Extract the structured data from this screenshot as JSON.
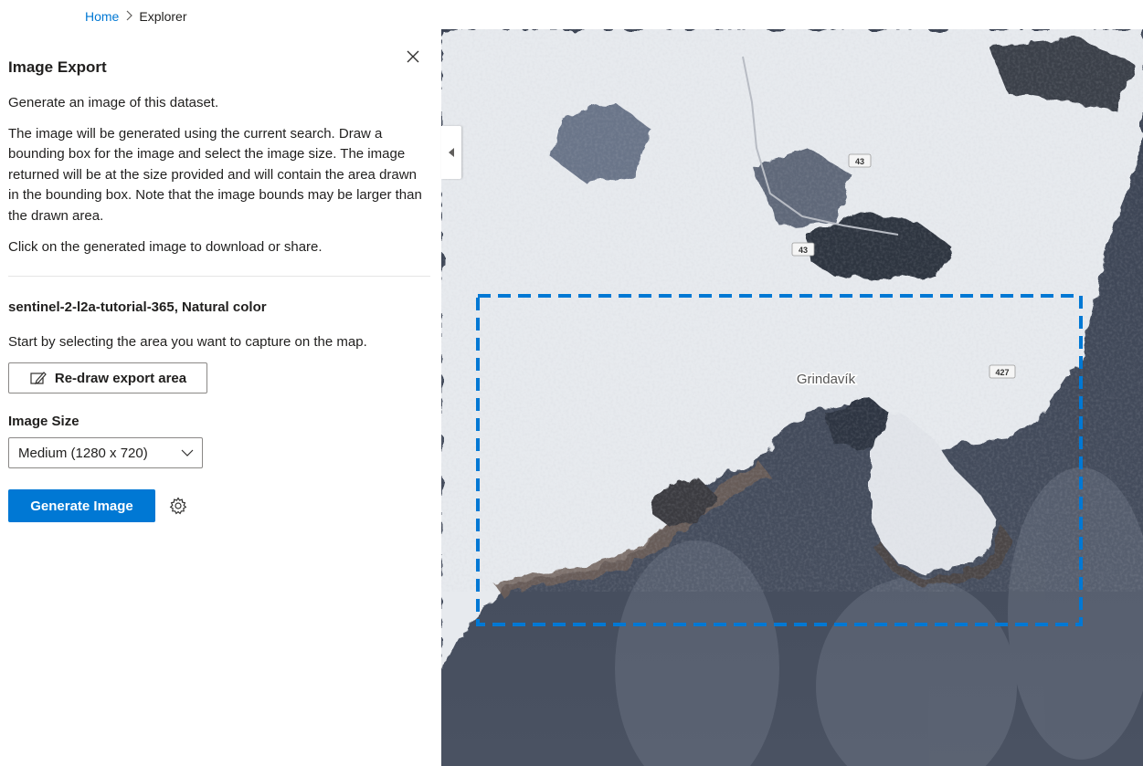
{
  "breadcrumb": {
    "home": "Home",
    "current": "Explorer"
  },
  "panel": {
    "title": "Image Export",
    "intro_1": "Generate an image of this dataset.",
    "intro_2": "The image will be generated using the current search. Draw a bounding box for the image and select the image size. The image returned will be at the size provided and will contain the area drawn in the bounding box. Note that the image bounds may be larger than the drawn area.",
    "intro_3": "Click on the generated image to download or share.",
    "dataset_title": "sentinel-2-l2a-tutorial-365, Natural color",
    "hint": "Start by selecting the area you want to capture on the map.",
    "redraw_label": "Re-draw export area",
    "size_label": "Image Size",
    "size_value": "Medium (1280 x 720)",
    "generate_label": "Generate Image"
  },
  "map": {
    "place_label": "Grindavík",
    "road_labels": [
      "43",
      "43",
      "427"
    ],
    "selection_color": "#0078d4"
  },
  "colors": {
    "accent": "#0078d4",
    "sea": "#3f4757",
    "snow": "#eef0f4"
  }
}
